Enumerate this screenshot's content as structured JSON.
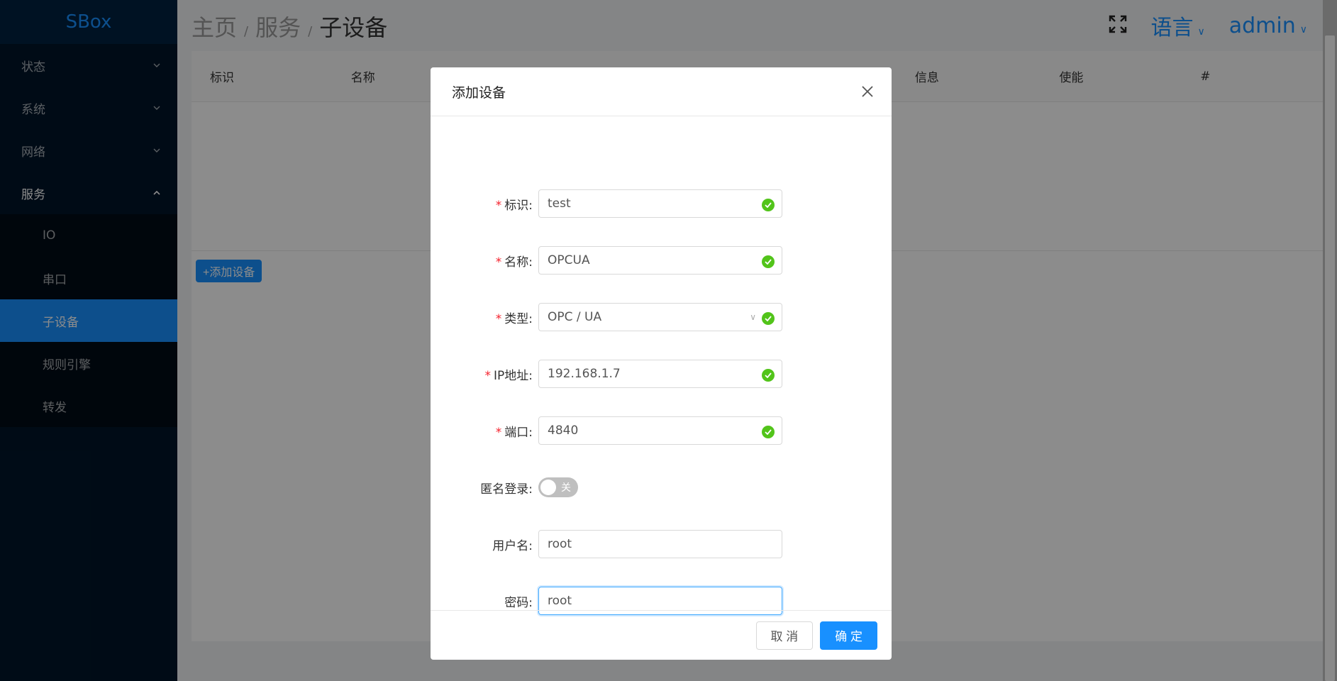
{
  "sidebar": {
    "brand": "SBox",
    "items": [
      {
        "label": "状态"
      },
      {
        "label": "系统"
      },
      {
        "label": "网络"
      },
      {
        "label": "服务"
      }
    ],
    "submenu": [
      {
        "label": "IO"
      },
      {
        "label": "串口"
      },
      {
        "label": "子设备"
      },
      {
        "label": "规则引擎"
      },
      {
        "label": "转发"
      }
    ]
  },
  "header": {
    "breadcrumb": [
      "主页",
      "服务",
      "子设备"
    ],
    "separator": "/",
    "language": "语言",
    "user": "admin"
  },
  "table": {
    "columns": [
      "标识",
      "名称",
      "",
      "",
      "",
      "",
      "信息",
      "使能",
      "#"
    ]
  },
  "add_button": "+添加设备",
  "modal": {
    "title": "添加设备",
    "fields": {
      "id": {
        "label": "标识:",
        "value": "test"
      },
      "name": {
        "label": "名称:",
        "value": "OPCUA"
      },
      "type": {
        "label": "类型:",
        "value": "OPC / UA"
      },
      "ip": {
        "label": "IP地址:",
        "value": "192.168.1.7"
      },
      "port": {
        "label": "端口:",
        "value": "4840"
      },
      "anonymous": {
        "label": "匿名登录:",
        "toggle_text": "关"
      },
      "username": {
        "label": "用户名:",
        "value": "root"
      },
      "password": {
        "label": "密码:",
        "value": "root"
      }
    },
    "required_mark": "*",
    "cancel": "取 消",
    "ok": "确 定"
  },
  "colors": {
    "primary": "#1890ff",
    "success": "#52c41a",
    "required": "#f5222d",
    "sidebar_bg": "#001529"
  }
}
